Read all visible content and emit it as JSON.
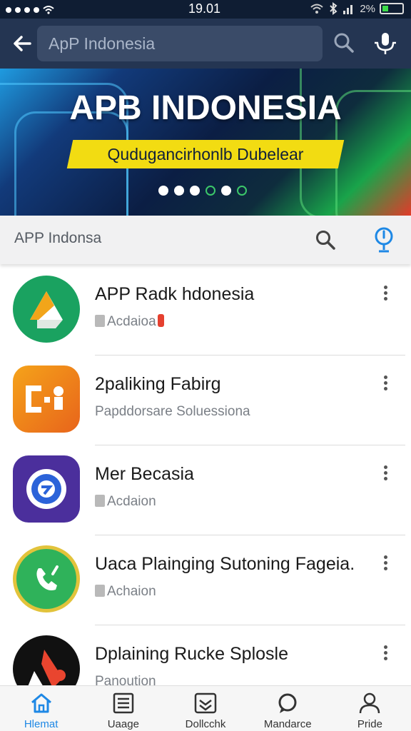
{
  "status_bar": {
    "time": "19.01",
    "battery_text": "2%"
  },
  "header": {
    "search_value": "ApP Indonesia",
    "back_icon": "arrow-left-icon",
    "search_icon": "search-icon",
    "mic_icon": "mic-icon"
  },
  "banner": {
    "title": "APB INDONESIA",
    "subtitle": "Qudugancirhonlb Dubelear",
    "dots": 6,
    "active_dot": 4
  },
  "search_row": {
    "value": "APP Indonsa"
  },
  "apps": [
    {
      "name": "APP Radk hdonesia",
      "subtitle": "Acdaioa",
      "icon": "drive-icon",
      "colors": [
        "#1aa260",
        "#f2a51a"
      ]
    },
    {
      "name": "2paliking Fabirg",
      "subtitle": "Papddorsare Soluessiona",
      "icon": "orange-app-icon",
      "colors": [
        "#f5a31a",
        "#e8641b"
      ]
    },
    {
      "name": "Mer Becasia",
      "subtitle": "Acdaion",
      "icon": "purple-app-icon",
      "colors": [
        "#5a3aa8",
        "#2b63d9"
      ]
    },
    {
      "name": "Uaca Plainging Sutoning Fageia.",
      "subtitle": "Achaion",
      "icon": "phone-app-icon",
      "colors": [
        "#2fb25a",
        "#e2c33b"
      ]
    },
    {
      "name": "Dplaining Rucke Splosle",
      "subtitle": "Panoution",
      "icon": "red-app-icon",
      "colors": [
        "#111111",
        "#e9452f"
      ]
    }
  ],
  "nav": [
    {
      "label": "Hlemat",
      "icon": "home-icon",
      "active": true
    },
    {
      "label": "Uaage",
      "icon": "list-icon",
      "active": false
    },
    {
      "label": "Dollcchk",
      "icon": "inbox-icon",
      "active": false
    },
    {
      "label": "Mandarce",
      "icon": "chat-icon",
      "active": false
    },
    {
      "label": "Pride",
      "icon": "profile-icon",
      "active": false
    }
  ],
  "colors": {
    "header": "#243552",
    "accent": "#1e88e5",
    "banner_yellow": "#f2dc12"
  }
}
